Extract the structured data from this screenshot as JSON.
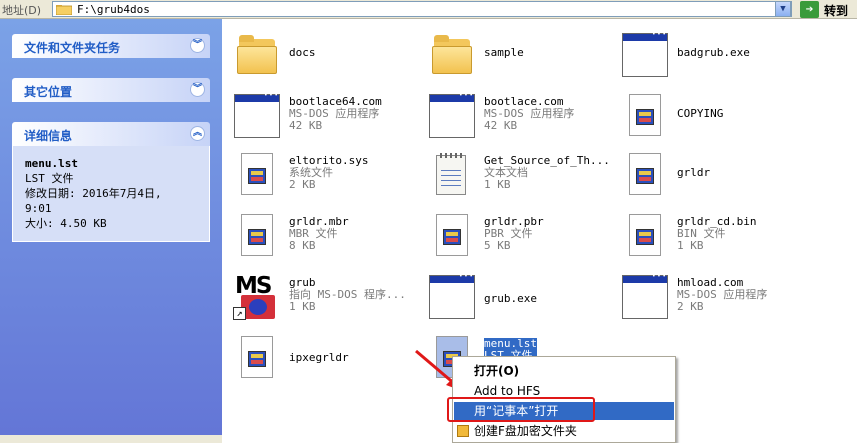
{
  "address": {
    "label": "地址(D)",
    "path": "F:\\grub4dos",
    "go_label": "转到"
  },
  "left_panels": [
    {
      "title": "文件和文件夹任务",
      "chevron": "︾"
    },
    {
      "title": "其它位置",
      "chevron": "︾"
    },
    {
      "title": "详细信息",
      "chevron": "︽",
      "details": {
        "name": "menu.lst",
        "type": "LST 文件",
        "modified": "修改日期: 2016年7月4日,",
        "modified_time": "9:01",
        "size": "大小: 4.50 KB"
      }
    }
  ],
  "files": [
    {
      "name": "docs",
      "line2": "",
      "line3": "",
      "icon": "folder-icon"
    },
    {
      "name": "sample",
      "line2": "",
      "line3": "",
      "icon": "folder-icon"
    },
    {
      "name": "badgrub.exe",
      "line2": "",
      "line3": "",
      "icon": "window-app-icon"
    },
    {
      "name": "bootlace64.com",
      "line2": "MS-DOS 应用程序",
      "line3": "42 KB",
      "icon": "window-app-icon"
    },
    {
      "name": "bootlace.com",
      "line2": "MS-DOS 应用程序",
      "line3": "42 KB",
      "icon": "window-app-icon"
    },
    {
      "name": "COPYING",
      "line2": "",
      "line3": "",
      "icon": "generic-file-icon"
    },
    {
      "name": "eltorito.sys",
      "line2": "系统文件",
      "line3": "2 KB",
      "icon": "generic-file-icon"
    },
    {
      "name": "Get_Source_of_Th...",
      "line2": "文本文档",
      "line3": "1 KB",
      "icon": "notepad-icon"
    },
    {
      "name": "grldr",
      "line2": "",
      "line3": "",
      "icon": "generic-file-icon"
    },
    {
      "name": "grldr.mbr",
      "line2": "MBR 文件",
      "line3": "8 KB",
      "icon": "generic-file-icon"
    },
    {
      "name": "grldr.pbr",
      "line2": "PBR 文件",
      "line3": "5 KB",
      "icon": "generic-file-icon"
    },
    {
      "name": "grldr_cd.bin",
      "line2": "BIN 文件",
      "line3": "1 KB",
      "icon": "generic-file-icon"
    },
    {
      "name": "grub",
      "line2": "指向 MS-DOS 程序...",
      "line3": "1 KB",
      "icon": "msdos-shortcut-icon",
      "icon_text": "MS"
    },
    {
      "name": "grub.exe",
      "line2": "",
      "line3": "",
      "icon": "window-app-icon"
    },
    {
      "name": "hmload.com",
      "line2": "MS-DOS 应用程序",
      "line3": "2 KB",
      "icon": "window-app-icon"
    },
    {
      "name": "ipxegrldr",
      "line2": "",
      "line3": "",
      "icon": "generic-file-icon"
    },
    {
      "name": "menu.lst",
      "line2": "LST 文件",
      "line3": "",
      "icon": "generic-file-icon",
      "selected": true
    }
  ],
  "context_menu": {
    "items": [
      {
        "label": "打开(O)",
        "bold": true
      },
      {
        "label": "Add to HFS",
        "bold": false
      },
      {
        "label": "用“记事本”打开",
        "highlighted": true
      },
      {
        "label": "创建F盘加密文件夹",
        "icon": "encrypt-folder-icon"
      }
    ]
  },
  "colors": {
    "selection": "#316ac5",
    "taskpane": "#6375d6",
    "annotation": "#e01818"
  }
}
